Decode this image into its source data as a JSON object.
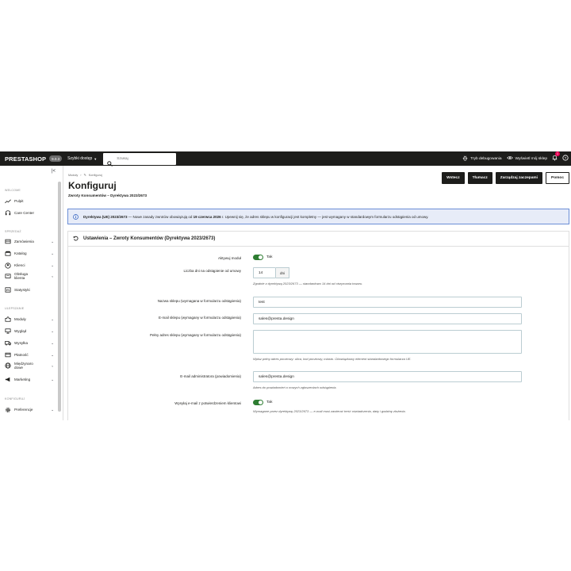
{
  "topbar": {
    "logo": "PRESTASHOP",
    "version": "9.0.3",
    "quick_access": "Szybki dostęp",
    "search_placeholder": "Szukaj",
    "debug_mode": "Tryb debugowania",
    "view_shop": "Wyświetl mój sklep",
    "notifications_count": "1"
  },
  "sidebar": {
    "items_top": [
      {
        "label": "Pulpit",
        "icon": "trend-icon"
      },
      {
        "label": "Care Center",
        "icon": "headset-icon"
      }
    ],
    "section_sell": "SPRZEDAŻ",
    "section_welcome": "WELCOME",
    "items_sell": [
      {
        "label": "Zamówienia",
        "icon": "cart-icon"
      },
      {
        "label": "Katalog",
        "icon": "store-icon"
      },
      {
        "label": "Klienci",
        "icon": "account-icon"
      },
      {
        "label": "Obsługa klienta",
        "icon": "chat-icon"
      },
      {
        "label": "Statystyki",
        "icon": "stats-icon"
      }
    ],
    "section_improve": "ULEPSZANIE",
    "items_improve": [
      {
        "label": "Moduły",
        "icon": "puzzle-icon"
      },
      {
        "label": "Wygląd",
        "icon": "desktop-icon"
      },
      {
        "label": "Wysyłka",
        "icon": "truck-icon"
      },
      {
        "label": "Płatność",
        "icon": "card-icon"
      },
      {
        "label": "Międzynarodowe",
        "icon": "globe-icon"
      },
      {
        "label": "Marketing",
        "icon": "megaphone-icon"
      }
    ],
    "section_config": "KONFIGURUJ",
    "items_config": [
      {
        "label": "Preferencje",
        "icon": "gear-icon"
      }
    ]
  },
  "header": {
    "breadcrumb": [
      "Moduły",
      "Konfiguruj"
    ],
    "title": "Konfiguruj",
    "subtitle": "Zwroty Konsumentów – Dyrektywa 2023/2673",
    "buttons": {
      "back": "Wstecz",
      "translate": "Tłumacz",
      "manage_hooks": "Zarządzaj zaczepami",
      "help": "Pomoc"
    }
  },
  "alert": {
    "bold_lead": "Dyrektywa (UE) 2023/2673",
    "text_mid": " — Nowe zasady zwrotów obowiązują od ",
    "bold_date": "19 czerwca 2026",
    "text_end": " r. Upewnij się, że adres sklepu w konfiguracji jest kompletny — jest wymagany w standardowym formularzu odstąpienia od umowy."
  },
  "form": {
    "heading": "Ustawienia – Zwroty Konsumentów (Dyrektywa 2023/2673)",
    "active_label": "Aktywuj moduł",
    "active_value": "Tak",
    "days_label": "Liczba dni na odstąpienie od umowy",
    "days_value": "14",
    "days_unit": "dni",
    "days_help": "Zgodnie z dyrektywą 2023/2673 — standardowo 14 dni od otrzymania towaru.",
    "shop_name_label": "Nazwa sklepu (wymagana w formularzu odstąpienia)",
    "shop_name_value": "test",
    "shop_email_label": "E-mail sklepu (wymagany w formularzu odstąpienia)",
    "shop_email_value": "sales@presta.design",
    "address_label": "Pełny adres sklepu (wymagany w formularzu odstąpienia)",
    "address_value": "",
    "address_help": "Wpisz pełny adres pocztowy: ulica, kod pocztowy, miasto. Obowiązkowy element standardowego formularza UE.",
    "admin_email_label": "E-mail administratora (powiadomienia)",
    "admin_email_value": "sales@presta.design",
    "admin_email_help": "Adres do powiadomień o nowych zgłoszeniach odstąpienia.",
    "confirm_label": "Wysyłaj e-mail z potwierdzeniem klientowi",
    "confirm_value": "Tak",
    "confirm_help": "Wymagane przez dyrektywę 2023/2673 — e-mail musi zawierać treść oświadczenia, datę i godzinę złożenia."
  },
  "colors": {
    "topbar": "#1d1d1b",
    "alert_bg": "#e7ecf8",
    "alert_border": "#6b8ed6",
    "toggle_on": "#2e7d32"
  }
}
